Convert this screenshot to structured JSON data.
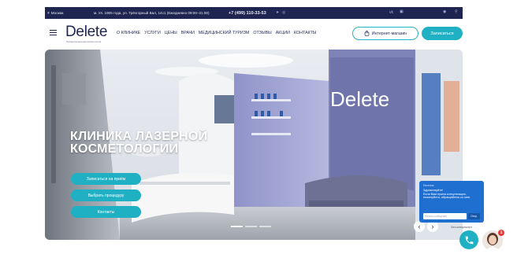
{
  "topbar": {
    "city": "Москва",
    "address": "м. Ул. 1905 года, ул. Трёхгорный Вал, 14с1 (Ежедневно 09:00–21:00)",
    "phone": "+7 (499) 110-33-53"
  },
  "header": {
    "logo": "Delete",
    "logo_sub": "Профессиональная косметология",
    "nav": [
      "О КЛИНИКЕ",
      "УСЛУГИ",
      "ЦЕНЫ",
      "ВРАЧИ",
      "МЕДИЦИНСКИЙ ТУРИЗМ",
      "ОТЗЫВЫ",
      "АКЦИИ",
      "КОНТАКТЫ"
    ],
    "shop_label": "Интернет-магазин",
    "signup_label": "Записаться"
  },
  "hero": {
    "title": "КЛИНИКА ЛАЗЕРНОЙ\nКОСМЕТОЛОГИИ",
    "wall_logo": "Delete",
    "buttons": [
      "Записаться на приём",
      "Выбрать процедуру",
      "Контакты"
    ],
    "slides": 3,
    "active_slide": 0
  },
  "chat": {
    "agent": "Евгения",
    "message": "Здравствуйте!\nЕсли Вам нужна консультация, пожалуйста, обращайтесь ко мне.",
    "input_placeholder": "Начать сообщение",
    "send_label": "Отпр.",
    "footer": "Чат-консультант",
    "badge": "1"
  },
  "colors": {
    "navy": "#1d2550",
    "accent": "#1fb0c4",
    "chat_blue": "#1e6fd0"
  }
}
